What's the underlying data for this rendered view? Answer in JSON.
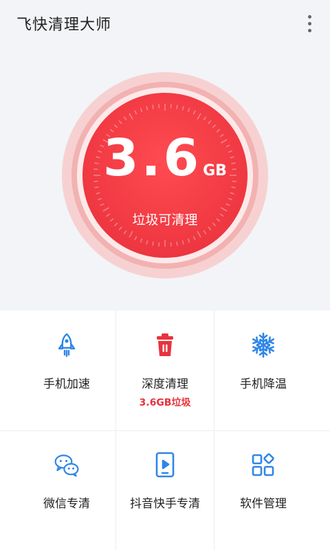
{
  "app": {
    "title": "飞快清理大师"
  },
  "gauge": {
    "value": "3.6",
    "unit": "GB",
    "label": "垃圾可清理"
  },
  "features": [
    {
      "label": "手机加速",
      "icon": "rocket-icon"
    },
    {
      "label": "深度清理",
      "sub": "3.6GB垃圾",
      "icon": "trash-icon"
    },
    {
      "label": "手机降温",
      "icon": "snowflake-icon"
    },
    {
      "label": "微信专清",
      "icon": "wechat-icon"
    },
    {
      "label": "抖音快手专清",
      "icon": "video-play-icon"
    },
    {
      "label": "软件管理",
      "icon": "apps-grid-icon"
    }
  ],
  "colors": {
    "accent_red": "#e8333d",
    "icon_blue": "#2f86e8",
    "background": "#f2f4f7"
  }
}
